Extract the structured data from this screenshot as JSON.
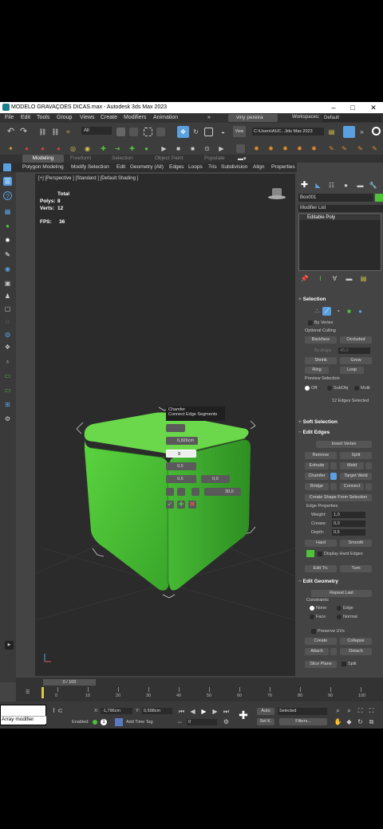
{
  "titlebar": {
    "title": "MODELO GRAVAÇOES DICAS.max - Autodesk 3ds Max 2023"
  },
  "menu": [
    "File",
    "Edit",
    "Tools",
    "Group",
    "Views",
    "Create",
    "Modifiers",
    "Animation"
  ],
  "user": "viny pereira",
  "workspaces_label": "Workspaces:",
  "workspace_value": "Default",
  "toolbar": {
    "filter": "All",
    "view_label": "View",
    "path": "C:\\Users\\AUC...3ds Max 2023"
  },
  "ribbon_tabs": [
    "Modeling",
    "Freeform",
    "Selection",
    "Object Paint",
    "Populate"
  ],
  "ribbon_items": [
    "Polygon Modeling",
    "Modify Selection",
    "Edit",
    "Geometry (All)",
    "Edges",
    "Loops",
    "Tris",
    "Subdivision",
    "Align",
    "Properties"
  ],
  "viewport": {
    "label": "[+] [Perspective ] [Standard ] [Default Shading ]",
    "stats_title": "Total",
    "polys_label": "Polys:",
    "polys": "8",
    "verts_label": "Verts:",
    "verts": "12",
    "fps_label": "FPS:",
    "fps": "36"
  },
  "caddy": {
    "title": "Chamfer",
    "subtitle": "Connect Edge Segments",
    "amount": "6,826cm",
    "segments": "9",
    "tension": "0,5",
    "v1": "0,5",
    "v2": "0,0",
    "angle": "30,0"
  },
  "cmd": {
    "object_name": "Box001",
    "modifier_list": "Modifier List",
    "stack_item": "Editable Poly"
  },
  "selection": {
    "header": "Selection",
    "by_vertex": "By Vertex",
    "ignore": "Optional Culling",
    "backface": "Backface",
    "occluded": "Occluded",
    "by_angle": "By Angle",
    "angle_val": "45,0",
    "shrink": "Shrink",
    "grow": "Grow",
    "ring": "Ring",
    "loop": "Loop",
    "preview": "Preview Selection",
    "off": "Off",
    "subobj": "SubObj",
    "multi": "Multi",
    "selected": "12 Edges Selected"
  },
  "soft_selection": {
    "header": "Soft Selection"
  },
  "edit_edges": {
    "header": "Edit Edges",
    "insert_vertex": "Insert Vertex",
    "remove": "Remove",
    "split": "Split",
    "extrude": "Extrude",
    "weld": "Weld",
    "chamfer": "Chamfer",
    "target_weld": "Target Weld",
    "bridge": "Bridge",
    "connect": "Connect",
    "create_shape": "Create Shape From Selection",
    "edge_props": "Edge Properties",
    "weight_label": "Weight:",
    "weight": "1,0",
    "crease_label": "Crease:",
    "crease": "0,0",
    "depth_label": "Depth:",
    "depth": "0,5",
    "hard": "Hard",
    "smooth": "Smooth",
    "display_hard": "Display Hard Edges",
    "edit_tri": "Edit Tri.",
    "turn": "Turn"
  },
  "edit_geometry": {
    "header": "Edit Geometry",
    "repeat_last": "Repeat Last",
    "constraints": "Constraints",
    "none": "None",
    "edge": "Edge",
    "face": "Face",
    "normal": "Normal",
    "preserve_uvs": "Preserve UVs",
    "create": "Create",
    "collapse": "Collapse",
    "attach": "Attach",
    "detach": "Detach",
    "slice_plane": "Slice Plane",
    "split": "Split"
  },
  "timeline": {
    "frame": "0 / 100",
    "ticks": [
      "0",
      "10",
      "20",
      "30",
      "40",
      "50",
      "60",
      "70",
      "80",
      "90",
      "100"
    ]
  },
  "status": {
    "maxscript": "Array modifier",
    "x_label": "X:",
    "x": "-1,796cm",
    "y_label": "Y:",
    "y": "0,598cm",
    "enabled": "Enabled:",
    "add_time_tag": "Add Time Tag",
    "auto": "Auto",
    "selected": "Selected",
    "set_k": "Set K.",
    "filters": "Filters...",
    "frame_val": "0"
  },
  "colors": {
    "green": "#4ec33a",
    "accent": "#5aa0e0",
    "panel": "#444444"
  }
}
